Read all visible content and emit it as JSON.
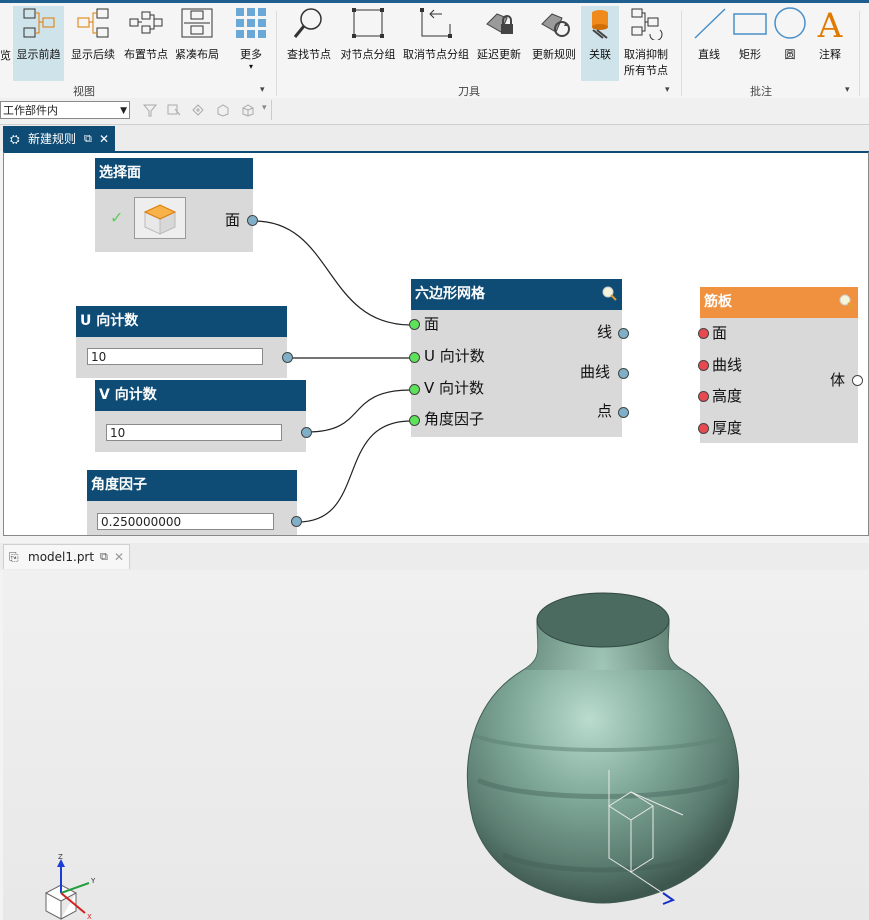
{
  "ribbon": {
    "items": [
      {
        "label": "览"
      },
      {
        "label": "显示前趋"
      },
      {
        "label": "显示后续"
      },
      {
        "label": "布置节点"
      },
      {
        "label": "紧凑布局"
      },
      {
        "label": "更多"
      },
      {
        "label": "查找节点"
      },
      {
        "label": "对节点分组"
      },
      {
        "label": "取消节点分组"
      },
      {
        "label": "延迟更新"
      },
      {
        "label": "更新规则"
      },
      {
        "label": "关联"
      },
      {
        "label": "取消抑制"
      },
      {
        "label": "所有节点"
      },
      {
        "label": "直线"
      },
      {
        "label": "矩形"
      },
      {
        "label": "圆"
      },
      {
        "label": "注释"
      }
    ],
    "groups": {
      "view": "视图",
      "blade": "刀具",
      "annotate": "批注"
    }
  },
  "toolbar": {
    "scope_value": "工作部件内"
  },
  "editor_tab": {
    "label": "新建规则"
  },
  "nodes": {
    "select_face": {
      "title": "选择面",
      "out": "面"
    },
    "u_count": {
      "title": "U 向计数",
      "value": "10"
    },
    "v_count": {
      "title": "V 向计数",
      "value": "10"
    },
    "angle": {
      "title": "角度因子",
      "value": "0.250000000"
    },
    "hex": {
      "title": "六边形网格",
      "in": [
        "面",
        "U 向计数",
        "V 向计数",
        "角度因子"
      ],
      "out": [
        "线",
        "曲线",
        "点"
      ]
    },
    "rib": {
      "title": "筋板",
      "in": [
        "面",
        "曲线",
        "高度",
        "厚度"
      ],
      "out": "体"
    }
  },
  "model_tab": {
    "label": "model1.prt"
  },
  "colors": {
    "accent": "#0f4c75",
    "node_orange": "#f0913f",
    "port_green": "#5ee25a",
    "port_red": "#e8484f"
  }
}
